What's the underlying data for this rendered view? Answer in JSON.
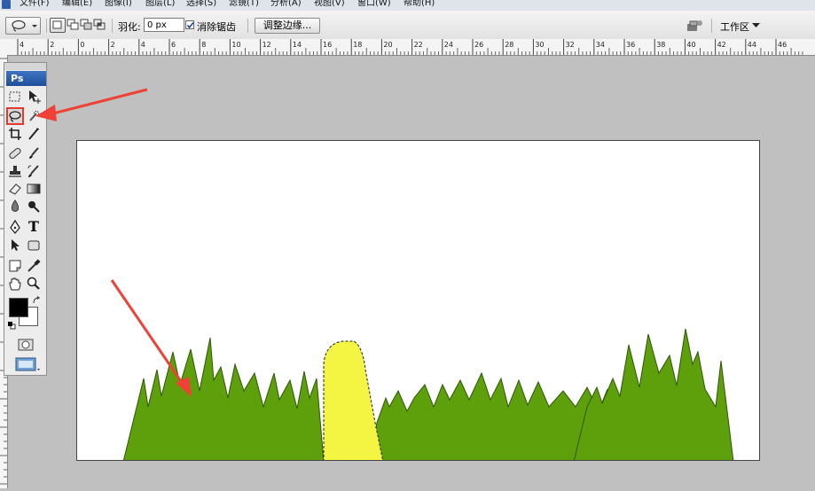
{
  "menu": {
    "items": [
      "文件(F)",
      "编辑(E)",
      "图像(I)",
      "图层(L)",
      "选择(S)",
      "滤镜(T)",
      "分析(A)",
      "视图(V)",
      "窗口(W)",
      "帮助(H)"
    ]
  },
  "options": {
    "feather_label": "羽化:",
    "feather_value": "0 px",
    "antialias_label": "消除锯齿",
    "antialias_checked": true,
    "refine_edge_label": "调整边缘...",
    "workspace_label": "工作区"
  },
  "ruler": {
    "labels": [
      "4",
      "2",
      "0",
      "2",
      "4",
      "6",
      "8",
      "10",
      "12",
      "14",
      "16",
      "18",
      "20",
      "22",
      "24",
      "26",
      "28",
      "30",
      "32",
      "34",
      "36",
      "38",
      "40",
      "42",
      "44",
      "46"
    ]
  },
  "toolbox": {
    "logo": "Ps",
    "tools": [
      {
        "name": "marquee-tool",
        "icon": "marquee-icon"
      },
      {
        "name": "move-tool",
        "icon": "move-icon"
      },
      {
        "name": "lasso-tool",
        "icon": "lasso-icon",
        "selected": true
      },
      {
        "name": "quick-selection-tool",
        "icon": "quick-selection-icon"
      },
      {
        "name": "crop-tool",
        "icon": "crop-icon"
      },
      {
        "name": "slice-tool",
        "icon": "slice-icon"
      },
      {
        "name": "healing-brush-tool",
        "icon": "bandage-icon"
      },
      {
        "name": "brush-tool",
        "icon": "brush-icon"
      },
      {
        "name": "clone-stamp-tool",
        "icon": "stamp-icon"
      },
      {
        "name": "history-brush-tool",
        "icon": "history-brush-icon"
      },
      {
        "name": "eraser-tool",
        "icon": "eraser-icon"
      },
      {
        "name": "gradient-tool",
        "icon": "gradient-icon"
      },
      {
        "name": "blur-tool",
        "icon": "blur-icon"
      },
      {
        "name": "dodge-tool",
        "icon": "dodge-icon"
      },
      {
        "name": "pen-tool",
        "icon": "pen-icon"
      },
      {
        "name": "type-tool",
        "icon": "type-icon",
        "glyph": "T"
      },
      {
        "name": "path-selection-tool",
        "icon": "path-arrow-icon"
      },
      {
        "name": "shape-tool",
        "icon": "rectangle-icon"
      },
      {
        "name": "notes-tool",
        "icon": "notes-icon"
      },
      {
        "name": "eyedropper-tool",
        "icon": "eyedropper-icon"
      },
      {
        "name": "hand-tool",
        "icon": "hand-icon"
      },
      {
        "name": "zoom-tool",
        "icon": "zoom-icon"
      }
    ],
    "foreground_color": "#000000",
    "background_color": "#ffffff"
  },
  "document": {
    "grass_color": "#5e9f0c",
    "selection_fill": "#f3f542",
    "annotation_color": "#ef4135"
  }
}
